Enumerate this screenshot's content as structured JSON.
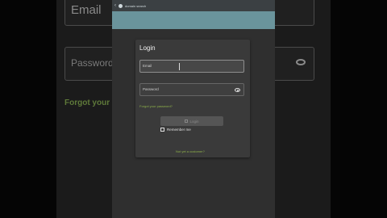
{
  "background": {
    "email_label": "Email",
    "password_label": "Password",
    "forgot_label": "Forgot your lo"
  },
  "statusbar": {
    "text": "domain search"
  },
  "login": {
    "title": "Login",
    "email_placeholder": "Email",
    "password_placeholder": "Password",
    "forgot_link": "Forgot your password?",
    "login_button": "Login",
    "remember_me": "Remember me",
    "signup_link": "Not yet a customer?"
  },
  "colors": {
    "accent_link": "#8db04a",
    "topbar": "#6a949c"
  }
}
